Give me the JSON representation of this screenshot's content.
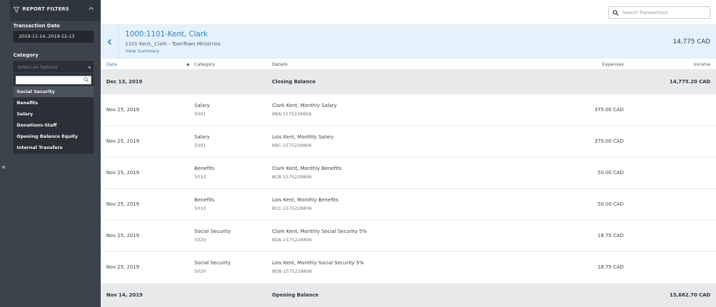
{
  "sidebar": {
    "title": "REPORT FILTERS",
    "transaction_date_label": "Transaction Date",
    "transaction_date_value": "2019-11-14..2019-12-13",
    "category_label": "Category",
    "category_placeholder": "Select an Options",
    "category_options": [
      "Social Security",
      "Benefits",
      "Salary",
      "Donations-Staff",
      "Opening Balance Equity",
      "Internal Transfers"
    ]
  },
  "topbar": {
    "search_placeholder": "Search Transactions"
  },
  "account": {
    "name": "1000:1101-Kent, Clark",
    "subtitle": "1101-Kent,_Clark - ToonTown Ministries",
    "view_summary": "View Summary",
    "total": "14,775 CAD"
  },
  "table": {
    "headers": {
      "date": "Date",
      "category": "Category",
      "details": "Details",
      "expenses": "Expenses",
      "income": "Income"
    },
    "closing": {
      "date": "Dec 13, 2019",
      "label": "Closing Balance",
      "amount": "14,775.20 CAD"
    },
    "rows": [
      {
        "date": "Nov 25, 2019",
        "category": "Salary",
        "code": "5001",
        "details": "Clark Kent, Monthly Salary",
        "ref": "8BA-1575228806",
        "expense": "375.00 CAD",
        "income": ""
      },
      {
        "date": "Nov 25, 2019",
        "category": "Salary",
        "code": "5001",
        "details": "Lois Kent, Monthly Salary",
        "ref": "8BC-1575228806",
        "expense": "375.00 CAD",
        "income": ""
      },
      {
        "date": "Nov 25, 2019",
        "category": "Benefits",
        "code": "5010",
        "details": "Clark Kent, Monthly Benefits",
        "ref": "8CB-1575228806",
        "expense": "50.00 CAD",
        "income": ""
      },
      {
        "date": "Nov 25, 2019",
        "category": "Benefits",
        "code": "5010",
        "details": "Lois Kent, Monthly Benefits",
        "ref": "8CC-1575228806",
        "expense": "50.00 CAD",
        "income": ""
      },
      {
        "date": "Nov 25, 2019",
        "category": "Social Security",
        "code": "5020",
        "details": "Clark Kent, Monthly Social Security 5%",
        "ref": "8DA-1575228806",
        "expense": "18.75 CAD",
        "income": ""
      },
      {
        "date": "Nov 25, 2019",
        "category": "Social Security",
        "code": "5020",
        "details": "Lois Kent, Monthly Social Security 5%",
        "ref": "8DB-1575228806",
        "expense": "18.75 CAD",
        "income": ""
      }
    ],
    "opening": {
      "date": "Nov 14, 2019",
      "label": "Opening Balance",
      "amount": "15,662.70 CAD"
    }
  },
  "colors": {
    "sidebar_bg": "#3d434b",
    "accent": "#2d7fc1",
    "header_band": "#e6f2fb",
    "summary_row": "#e7e9eb"
  }
}
